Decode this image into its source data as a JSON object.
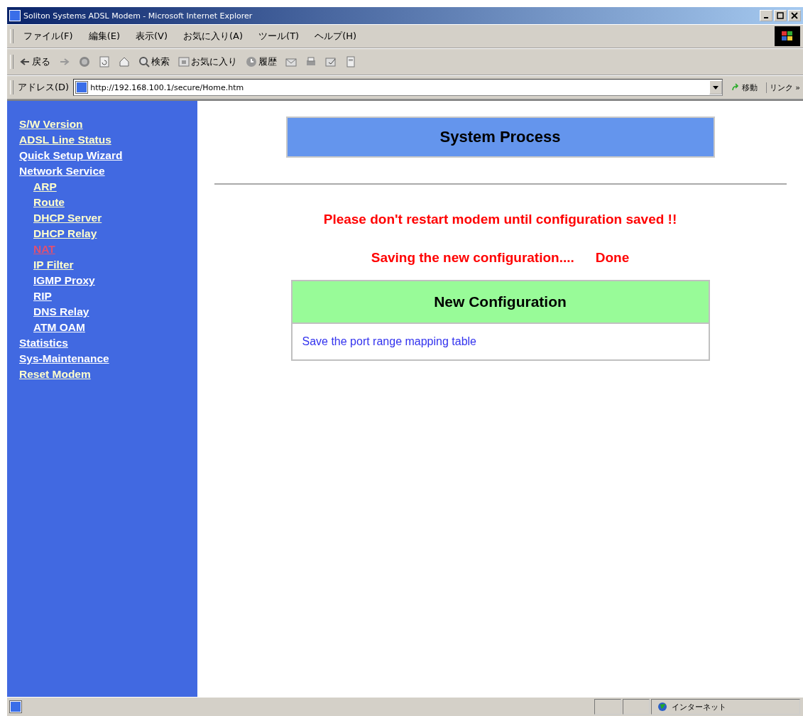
{
  "window": {
    "title": "Soliton Systems ADSL Modem - Microsoft Internet Explorer"
  },
  "menu": [
    "ファイル(F)",
    "編集(E)",
    "表示(V)",
    "お気に入り(A)",
    "ツール(T)",
    "ヘルプ(H)"
  ],
  "toolbar": [
    {
      "kind": "back",
      "label": "戻る"
    },
    {
      "kind": "forward"
    },
    {
      "kind": "stop"
    },
    {
      "kind": "refresh"
    },
    {
      "kind": "home"
    },
    {
      "kind": "search",
      "label": "検索"
    },
    {
      "kind": "favorites",
      "label": "お気に入り"
    },
    {
      "kind": "history",
      "label": "履歴"
    },
    {
      "kind": "mail"
    },
    {
      "kind": "print"
    },
    {
      "kind": "edit"
    },
    {
      "kind": "discuss"
    }
  ],
  "address": {
    "label": "アドレス(D)",
    "value": "http://192.168.100.1/secure/Home.htm",
    "go": "移動",
    "links": "リンク »"
  },
  "sidebar": {
    "items": [
      {
        "label": "S/W Version",
        "visited": true,
        "selected": false
      },
      {
        "label": "ADSL Line Status",
        "visited": true,
        "selected": false
      },
      {
        "label": "Quick Setup Wizard",
        "visited": false,
        "selected": false
      },
      {
        "label": "Network Service",
        "visited": false,
        "selected": false,
        "children": [
          {
            "label": "ARP",
            "visited": true,
            "selected": false
          },
          {
            "label": "Route",
            "visited": true,
            "selected": false
          },
          {
            "label": "DHCP Server",
            "visited": true,
            "selected": false
          },
          {
            "label": "DHCP Relay",
            "visited": true,
            "selected": false
          },
          {
            "label": "NAT",
            "selected": true
          },
          {
            "label": "IP Filter",
            "visited": true,
            "selected": false
          },
          {
            "label": "IGMP Proxy",
            "visited": false,
            "selected": false
          },
          {
            "label": "RIP",
            "visited": false,
            "selected": false
          },
          {
            "label": "DNS Relay",
            "visited": false,
            "selected": false
          },
          {
            "label": "ATM OAM",
            "visited": false,
            "selected": false
          }
        ]
      },
      {
        "label": "Statistics",
        "visited": false,
        "selected": false
      },
      {
        "label": "Sys-Maintenance",
        "visited": false,
        "selected": false
      },
      {
        "label": "Reset Modem",
        "visited": true,
        "selected": false
      }
    ]
  },
  "main": {
    "heading": "System Process",
    "warning": "Please don't restart modem until configuration saved !!",
    "progress": "Saving the new configuration....",
    "progress_status": "Done",
    "panel": {
      "title": "New Configuration",
      "link": "Save the port range mapping table"
    }
  },
  "status_bar": {
    "zone": "インターネット"
  }
}
